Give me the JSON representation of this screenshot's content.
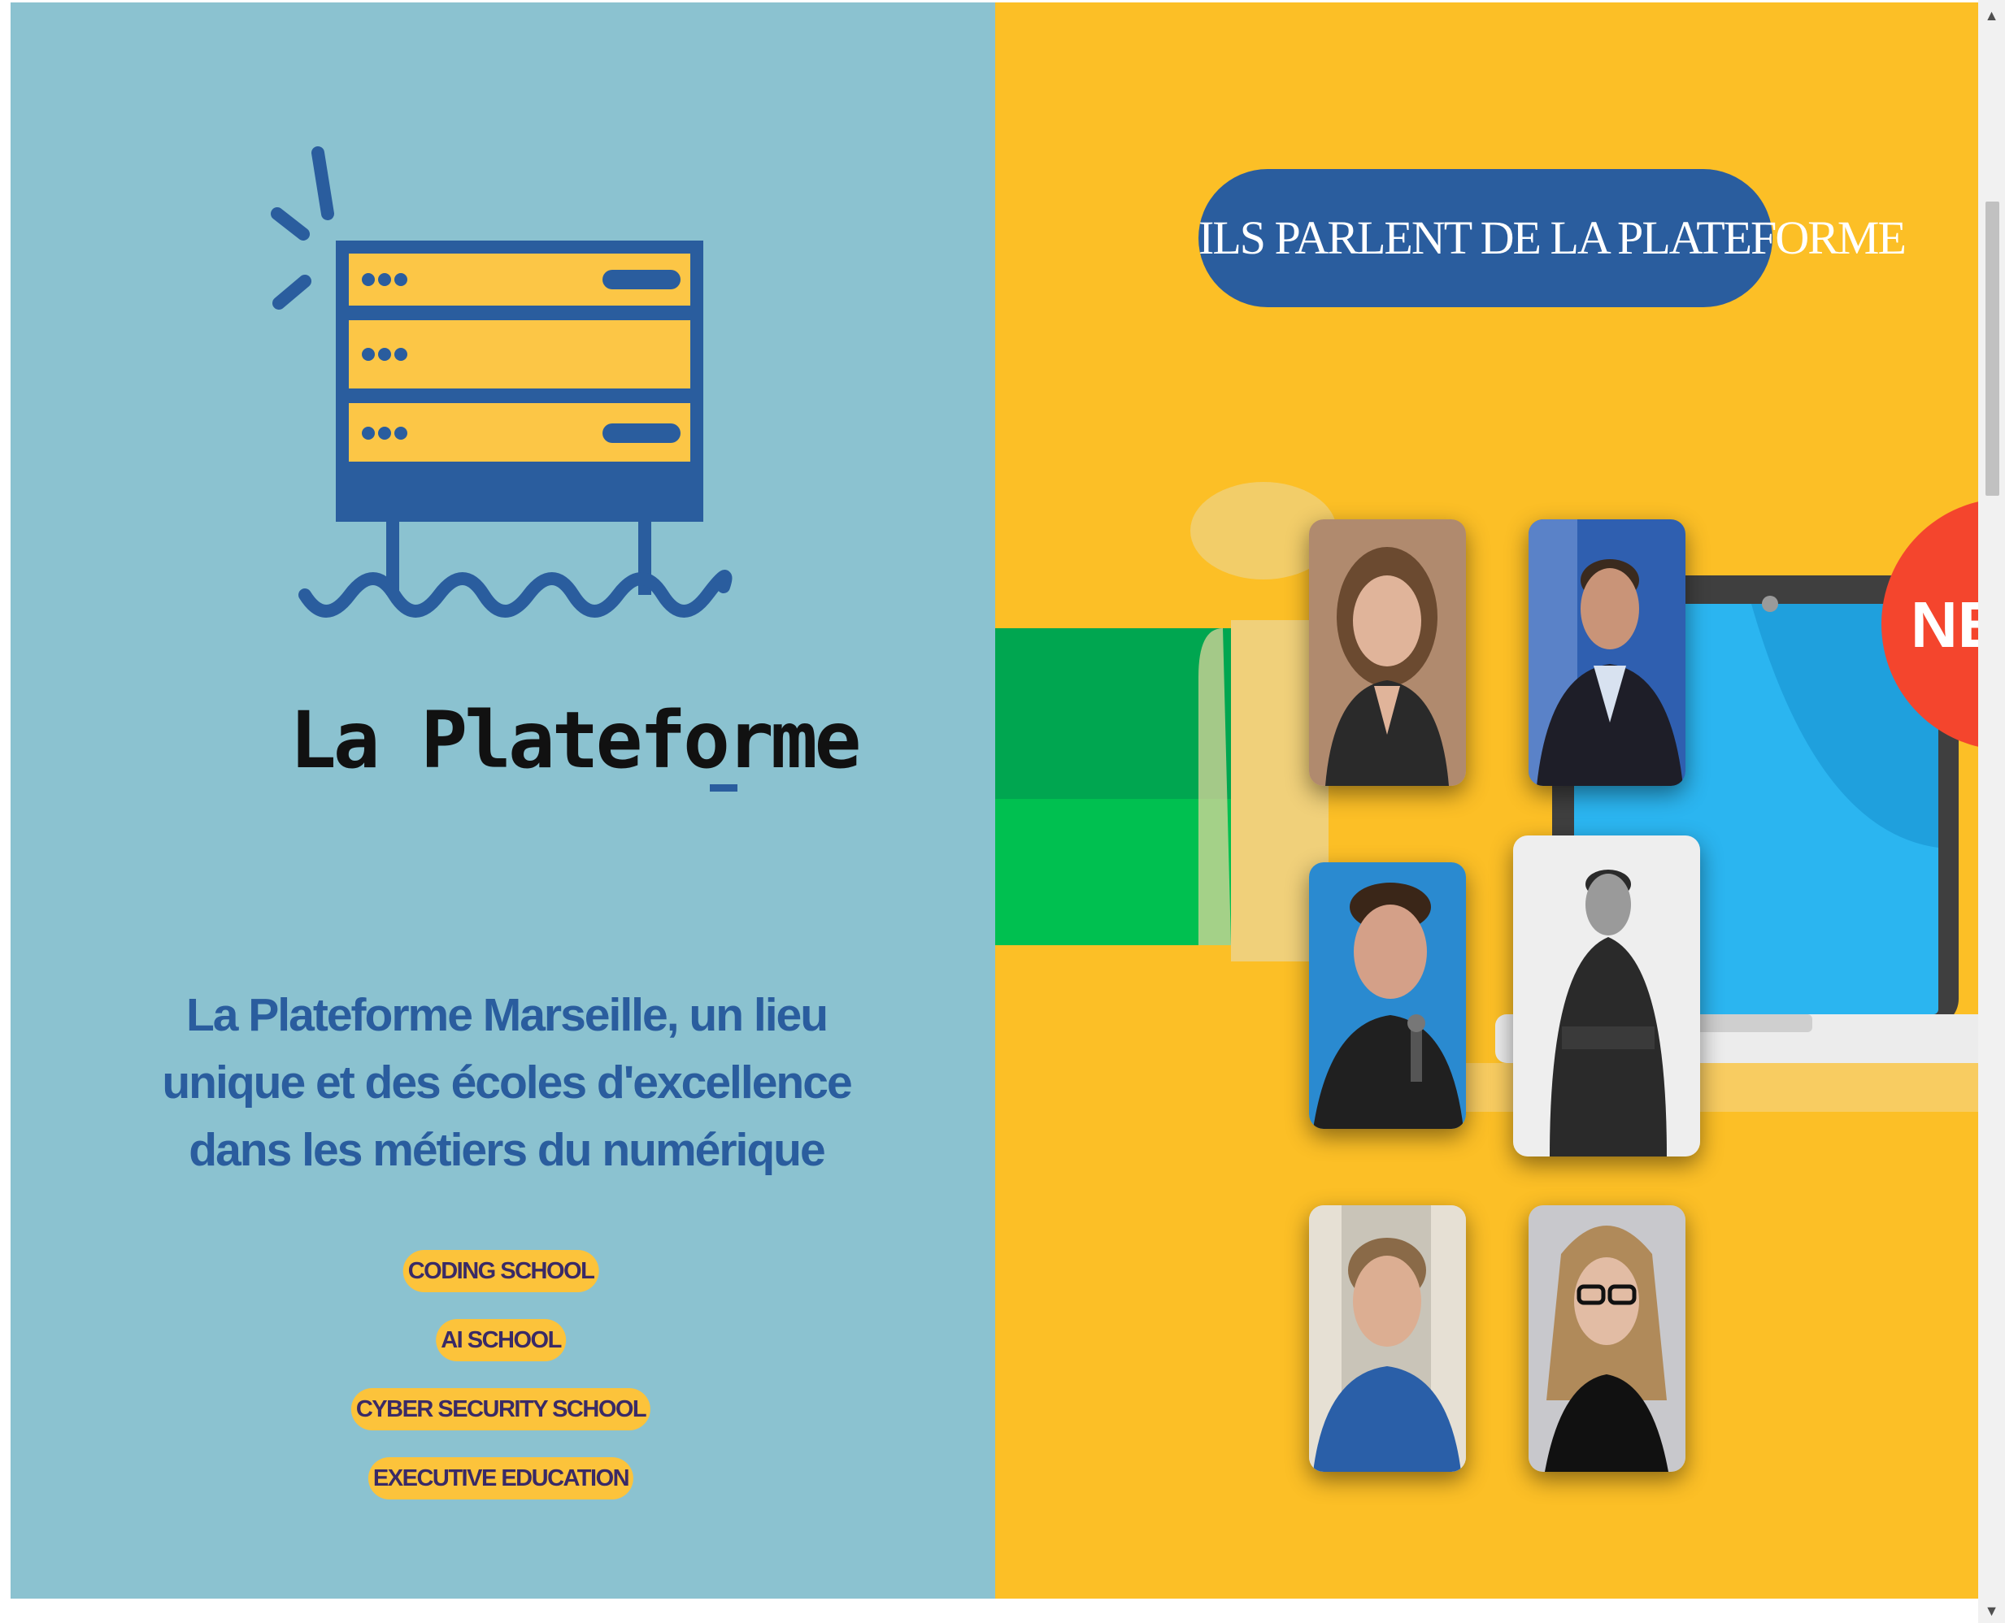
{
  "brand": {
    "name": "La Plateforme",
    "cursor": "_"
  },
  "tagline": "La Plateforme Marseille, un lieu unique et des écoles d'excellence dans les métiers du numérique",
  "schools": [
    "CODING SCHOOL",
    "AI SCHOOL",
    "CYBER SECURITY SCHOOL",
    "EXECUTIVE EDUCATION"
  ],
  "testimonials": {
    "heading": "ILS PARLENT DE LA PLATEFORME",
    "badge": "NEW",
    "photos": [
      {
        "name": "woman-portrait-1",
        "bg": "#b08a6e",
        "shirt": "#2a2a2a",
        "hair": "#6b4a30",
        "skin": "#e0b49a"
      },
      {
        "name": "man-portrait-1",
        "bg": "#2f5fb0",
        "shirt": "#1e1e28",
        "hair": "#3a2a1e",
        "skin": "#c99478"
      },
      {
        "name": "man-portrait-2",
        "bg": "#2a8ad0",
        "shirt": "#202020",
        "hair": "#3a2618",
        "skin": "#d4a088"
      },
      {
        "name": "man-portrait-3",
        "bg": "#eeeeee",
        "shirt": "#2a2a2a",
        "hair": "#2a2a2a",
        "skin": "#9a9a9a"
      },
      {
        "name": "man-portrait-4",
        "bg": "#c9c4b8",
        "shirt": "#2a5fa8",
        "hair": "#8a6a48",
        "skin": "#dcae92"
      },
      {
        "name": "woman-portrait-2",
        "bg": "#c8c8cc",
        "shirt": "#111111",
        "hair": "#b08a5a",
        "skin": "#e2bca4"
      }
    ]
  },
  "colors": {
    "left_bg": "#8bc2d0",
    "right_bg": "#fcbf26",
    "brand_blue": "#2a5d9e",
    "pill_yellow": "#fcc33b",
    "pill_text": "#3a2a66",
    "badge_red": "#f4452d"
  }
}
